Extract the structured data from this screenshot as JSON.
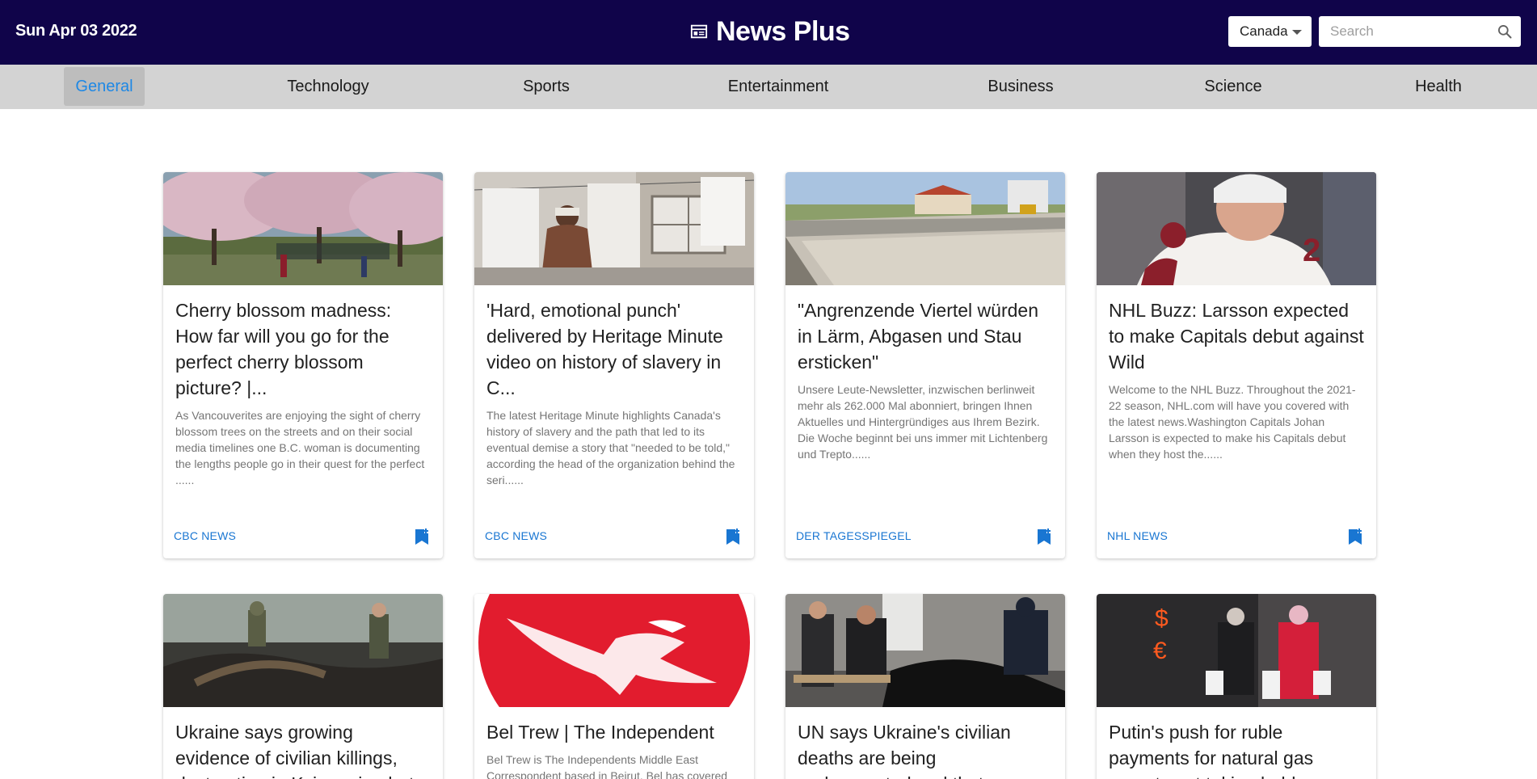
{
  "header": {
    "date": "Sun Apr 03 2022",
    "brand": "News Plus",
    "brand_icon": "newspaper-icon",
    "country": "Canada",
    "search_placeholder": "Search"
  },
  "nav": {
    "items": [
      "General",
      "Technology",
      "Sports",
      "Entertainment",
      "Business",
      "Science",
      "Health"
    ],
    "active": "General",
    "active_color": "#1e88e5"
  },
  "colors": {
    "header_bg": "#10044a",
    "nav_bg": "#d3d3d3",
    "source_link": "#1976d2"
  },
  "articles": [
    {
      "title": "Cherry blossom madness: How far will you go for the perfect cherry blossom picture? |...",
      "description": "As Vancouverites are enjoying the sight of cherry blossom trees on the streets and on their social media timelines  one B.C. woman is documenting the lengths people go in their quest for the perfect ......",
      "source": "CBC NEWS",
      "image": "cherry-blossom-park-photo"
    },
    {
      "title": "'Hard, emotional punch' delivered by Heritage Minute video on history of slavery in C...",
      "description": "The latest Heritage Minute highlights Canada's history of slavery and the path that led to its eventual demise a story that \"needed to be told,\" according the head of the organization behind the seri......",
      "source": "CBC NEWS",
      "image": "woman-laundry-line-photo"
    },
    {
      "title": "\"Angrenzende Viertel würden in Lärm, Abgasen und Stau ersticken\"",
      "description": "Unsere Leute-Newsletter, inzwischen berlinweit mehr als 262.000 Mal abonniert, bringen Ihnen Aktuelles und Hintergründiges aus Ihrem Bezirk. Die Woche beginnt bei uns immer mit Lichtenberg und Trepto......",
      "source": "DER TAGESSPIEGEL",
      "image": "construction-canal-photo"
    },
    {
      "title": "NHL Buzz: Larsson expected to make Capitals debut against Wild",
      "description": "Welcome to the NHL Buzz. Throughout the 2021-22 season, NHL.com will have you covered with the latest news.Washington Capitals Johan Larsson is expected to make his Capitals debut when they host the......",
      "source": "NHL NEWS",
      "image": "hockey-player-photo"
    },
    {
      "title": "Ukraine says growing evidence of civilian killings, destruction in Kyiv region but...",
      "description": "",
      "source": "",
      "image": "destroyed-tank-soldiers-photo"
    },
    {
      "title": "Bel Trew | The Independent",
      "description": "Bel Trew is The Independents Middle East Correspondent based in Beirut. Bel has covered",
      "source": "",
      "image": "independent-eagle-logo"
    },
    {
      "title": "UN says Ukraine's civilian deaths are being undercounted and that",
      "description": "",
      "source": "",
      "image": "body-bags-photo"
    },
    {
      "title": "Putin's push for ruble payments for natural gas exports not taking hold",
      "description": "",
      "source": "",
      "image": "shoppers-exchange-sign-photo"
    }
  ]
}
